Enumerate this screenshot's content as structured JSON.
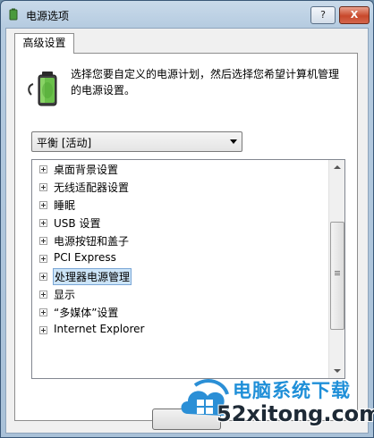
{
  "window": {
    "title": "电源选项",
    "help_label": "?",
    "close_label": "X"
  },
  "tabs": [
    {
      "label": "高级设置",
      "active": true
    }
  ],
  "description": "选择您要自定义的电源计划，然后选择您希望计算机管理的电源设置。",
  "plan_select": {
    "value": "平衡 [活动]"
  },
  "settings_tree": [
    {
      "label": "桌面背景设置",
      "selected": false
    },
    {
      "label": "无线适配器设置",
      "selected": false
    },
    {
      "label": "睡眠",
      "selected": false
    },
    {
      "label": "USB 设置",
      "selected": false
    },
    {
      "label": "电源按钮和盖子",
      "selected": false
    },
    {
      "label": "PCI Express",
      "selected": false
    },
    {
      "label": "处理器电源管理",
      "selected": true
    },
    {
      "label": "显示",
      "selected": false
    },
    {
      "label": "“多媒体”设置",
      "selected": false
    },
    {
      "label": "Internet Explorer",
      "selected": false
    }
  ],
  "watermark": {
    "cn_text": "电脑系统下载",
    "url_text": "52xitong.com"
  },
  "colors": {
    "selection_bg": "#cce4f7",
    "watermark_blue": "#1f8fd8"
  },
  "icons": [
    "power-options-icon",
    "battery-plug-icon",
    "expand-plus-icon",
    "chevron-down-icon",
    "cloud-windows-logo-icon"
  ]
}
